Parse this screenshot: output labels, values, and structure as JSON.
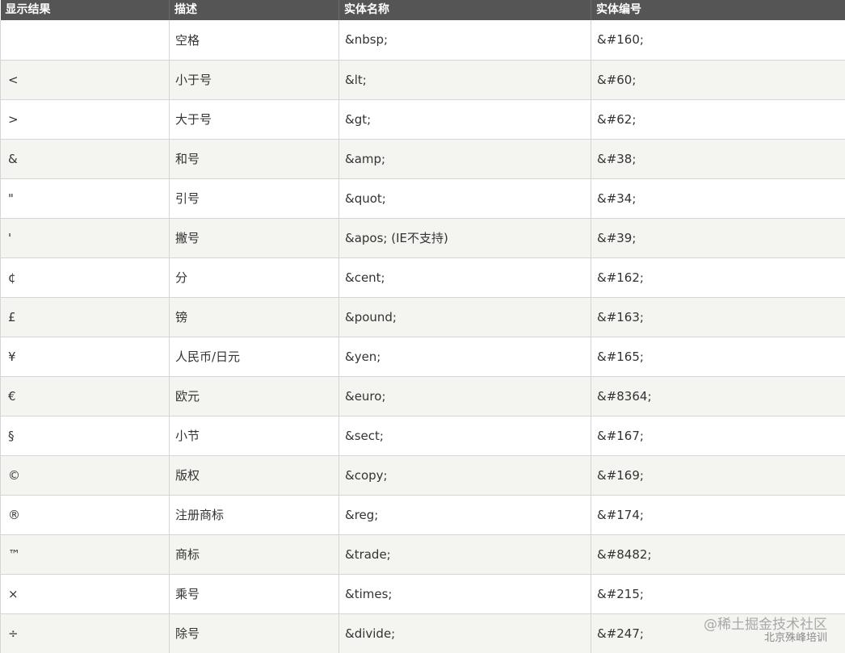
{
  "table": {
    "headers": [
      "显示结果",
      "描述",
      "实体名称",
      "实体编号"
    ],
    "rows": [
      {
        "result": "",
        "desc": "空格",
        "name": "&nbsp;",
        "number": "&#160;"
      },
      {
        "result": "<",
        "desc": "小于号",
        "name": "&lt;",
        "number": "&#60;"
      },
      {
        "result": ">",
        "desc": "大于号",
        "name": "&gt;",
        "number": "&#62;"
      },
      {
        "result": "&",
        "desc": "和号",
        "name": "&amp;",
        "number": "&#38;"
      },
      {
        "result": "\"",
        "desc": "引号",
        "name": "&quot;",
        "number": "&#34;"
      },
      {
        "result": "'",
        "desc": "撇号",
        "name": "&apos; (IE不支持)",
        "number": "&#39;"
      },
      {
        "result": "¢",
        "desc": "分",
        "name": "&cent;",
        "number": "&#162;"
      },
      {
        "result": "£",
        "desc": "镑",
        "name": "&pound;",
        "number": "&#163;"
      },
      {
        "result": "¥",
        "desc": "人民币/日元",
        "name": "&yen;",
        "number": "&#165;"
      },
      {
        "result": "€",
        "desc": "欧元",
        "name": "&euro;",
        "number": "&#8364;"
      },
      {
        "result": "§",
        "desc": "小节",
        "name": "&sect;",
        "number": "&#167;"
      },
      {
        "result": "©",
        "desc": "版权",
        "name": "&copy;",
        "number": "&#169;"
      },
      {
        "result": "®",
        "desc": "注册商标",
        "name": "&reg;",
        "number": "&#174;"
      },
      {
        "result": "™",
        "desc": "商标",
        "name": "&trade;",
        "number": "&#8482;"
      },
      {
        "result": "×",
        "desc": "乘号",
        "name": "&times;",
        "number": "&#215;"
      },
      {
        "result": "÷",
        "desc": "除号",
        "name": "&divide;",
        "number": "&#247;"
      }
    ]
  },
  "watermark": {
    "main": "@稀土掘金技术社区",
    "sub": "北京殊峰培训"
  }
}
